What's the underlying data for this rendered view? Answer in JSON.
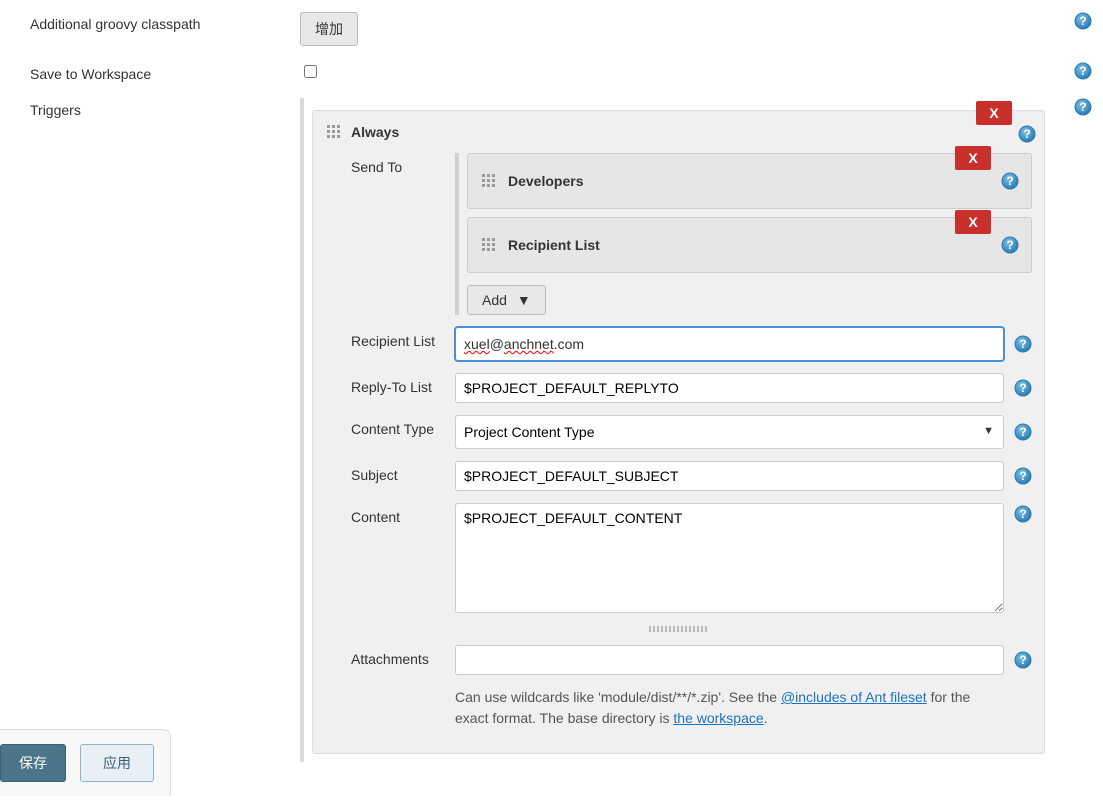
{
  "labels": {
    "additional_classpath": "Additional groovy classpath",
    "save_to_workspace": "Save to Workspace",
    "triggers": "Triggers"
  },
  "buttons": {
    "add_classpath": "增加",
    "add_sendto": "Add",
    "save": "保存",
    "apply": "应用",
    "close_x": "X"
  },
  "triggers": {
    "always": {
      "title": "Always",
      "send_to_label": "Send To",
      "items": [
        {
          "title": "Developers"
        },
        {
          "title": "Recipient List"
        }
      ]
    },
    "fields": {
      "recipient_list": {
        "label": "Recipient List",
        "value": "xuel@anchnet.com",
        "spell_parts": [
          "xuel",
          "@",
          "anchnet",
          ".com"
        ]
      },
      "reply_to_list": {
        "label": "Reply-To List",
        "value": "$PROJECT_DEFAULT_REPLYTO"
      },
      "content_type": {
        "label": "Content Type",
        "value": "Project Content Type"
      },
      "subject": {
        "label": "Subject",
        "value": "$PROJECT_DEFAULT_SUBJECT"
      },
      "content": {
        "label": "Content",
        "value": "$PROJECT_DEFAULT_CONTENT"
      },
      "attachments": {
        "label": "Attachments",
        "value": ""
      }
    },
    "attachments_help": {
      "prefix": "Can use wildcards like 'module/dist/**/*.zip'. See the ",
      "link1": "@includes of Ant fileset",
      "mid": " for the exact format. The base directory is ",
      "link2": "the workspace",
      "suffix": "."
    }
  }
}
